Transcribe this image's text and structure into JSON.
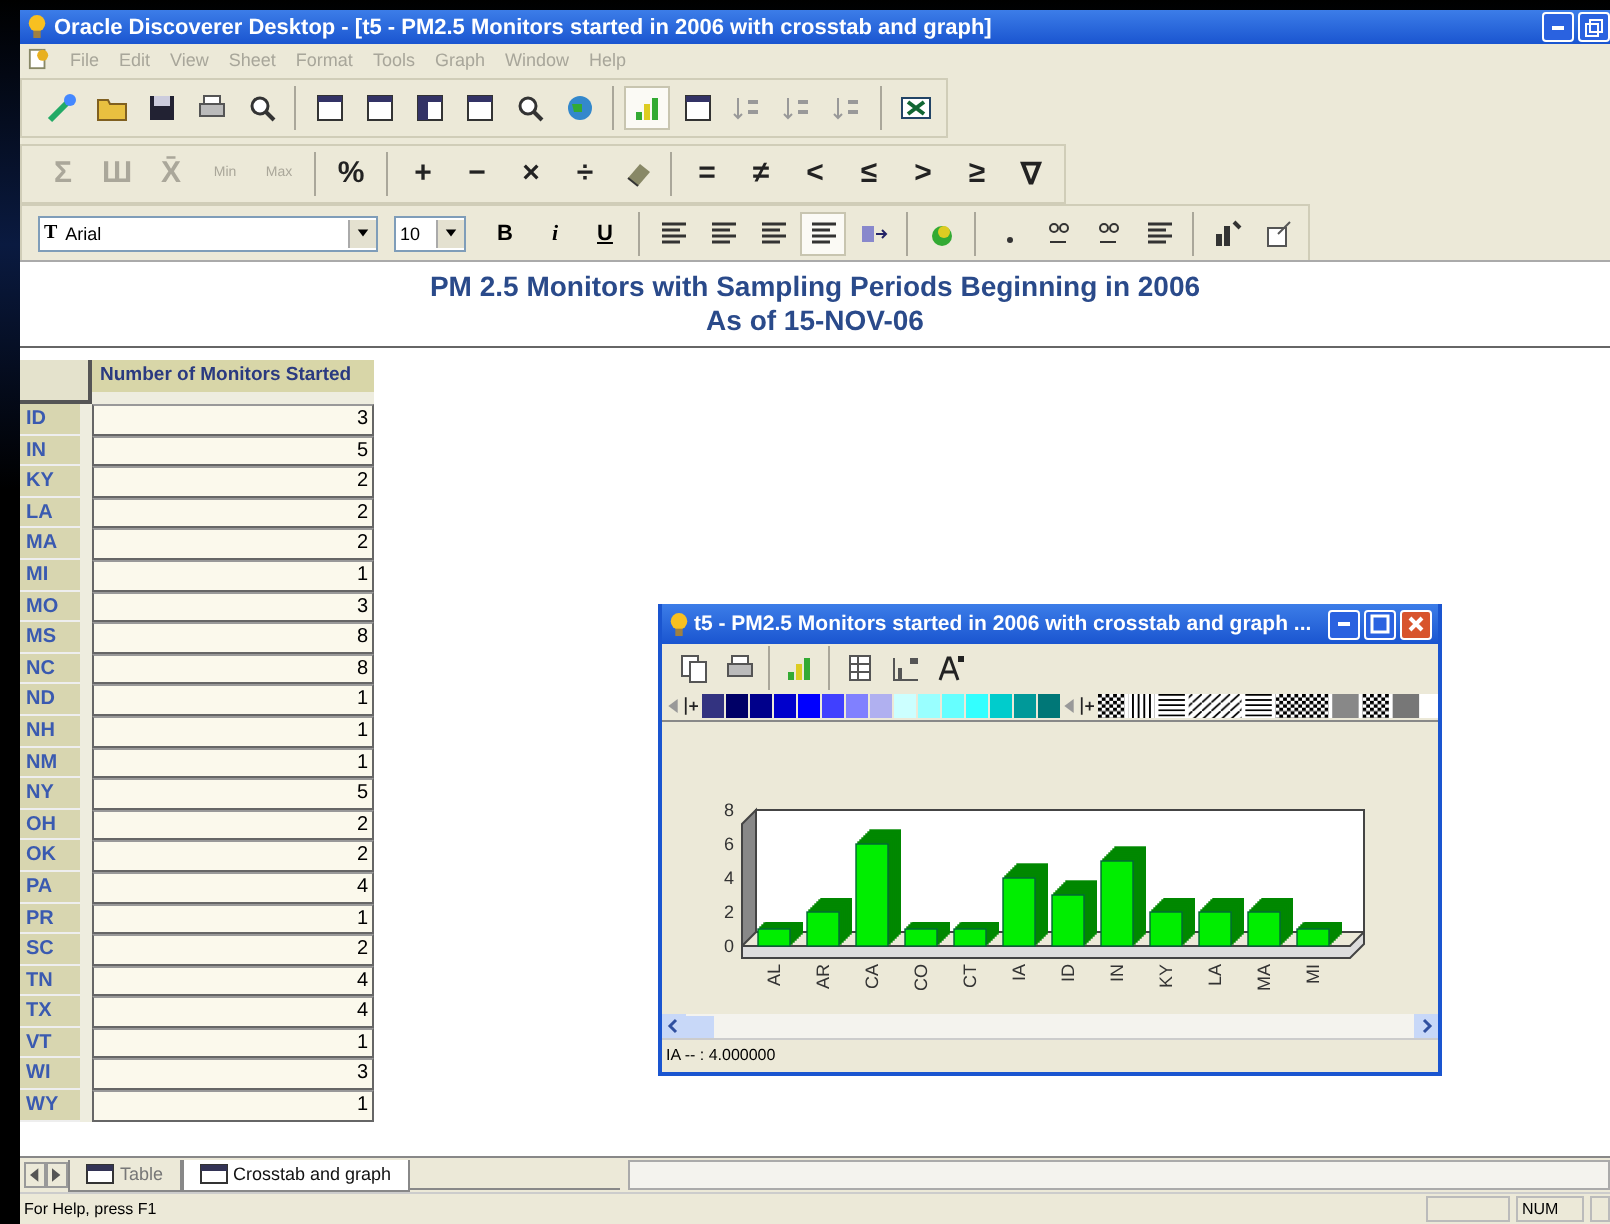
{
  "window": {
    "title": "Oracle Discoverer Desktop - [t5 - PM2.5 Monitors started in 2006 with crosstab and graph]"
  },
  "menu": [
    {
      "label": "File"
    },
    {
      "label": "Edit"
    },
    {
      "label": "View"
    },
    {
      "label": "Sheet"
    },
    {
      "label": "Format"
    },
    {
      "label": "Tools"
    },
    {
      "label": "Graph"
    },
    {
      "label": "Window"
    },
    {
      "label": "Help"
    }
  ],
  "calc_toolbar": [
    {
      "kind": "button",
      "label": "Σ",
      "disabled": true
    },
    {
      "kind": "button",
      "label": "Ш",
      "disabled": true
    },
    {
      "kind": "button",
      "label": "X̄",
      "disabled": true
    },
    {
      "kind": "button",
      "label": "Min",
      "disabled": true
    },
    {
      "kind": "button",
      "label": "Max",
      "disabled": true
    },
    {
      "kind": "sep"
    },
    {
      "kind": "button",
      "label": "%",
      "disabled": false
    },
    {
      "kind": "sep"
    },
    {
      "kind": "button",
      "label": "+",
      "disabled": false
    },
    {
      "kind": "button",
      "label": "−",
      "disabled": false
    },
    {
      "kind": "button",
      "label": "×",
      "disabled": false
    },
    {
      "kind": "button",
      "label": "÷",
      "disabled": false
    },
    {
      "kind": "eraser"
    },
    {
      "kind": "sep"
    },
    {
      "kind": "button",
      "label": "=",
      "disabled": false
    },
    {
      "kind": "button",
      "label": "≠",
      "disabled": false
    },
    {
      "kind": "button",
      "label": "<",
      "disabled": false
    },
    {
      "kind": "button",
      "label": "≤",
      "disabled": false
    },
    {
      "kind": "button",
      "label": ">",
      "disabled": false
    },
    {
      "kind": "button",
      "label": "≥",
      "disabled": false
    },
    {
      "kind": "button",
      "label": "∇",
      "disabled": false
    }
  ],
  "format_toolbar": {
    "font_glyph": "T",
    "font": "Arial",
    "size": "10",
    "bold": "B",
    "italic": "i",
    "underline": "U"
  },
  "report": {
    "title": "PM 2.5 Monitors with Sampling Periods Beginning in 2006",
    "subtitle": "As of 15-NOV-06"
  },
  "crosstab": {
    "column": "Number of Monitors Started",
    "rows": [
      {
        "state": "ID",
        "value": "3"
      },
      {
        "state": "IN",
        "value": "5"
      },
      {
        "state": "KY",
        "value": "2"
      },
      {
        "state": "LA",
        "value": "2"
      },
      {
        "state": "MA",
        "value": "2"
      },
      {
        "state": "MI",
        "value": "1"
      },
      {
        "state": "MO",
        "value": "3"
      },
      {
        "state": "MS",
        "value": "8"
      },
      {
        "state": "NC",
        "value": "8"
      },
      {
        "state": "ND",
        "value": "1"
      },
      {
        "state": "NH",
        "value": "1"
      },
      {
        "state": "NM",
        "value": "1"
      },
      {
        "state": "NY",
        "value": "5"
      },
      {
        "state": "OH",
        "value": "2"
      },
      {
        "state": "OK",
        "value": "2"
      },
      {
        "state": "PA",
        "value": "4"
      },
      {
        "state": "PR",
        "value": "1"
      },
      {
        "state": "SC",
        "value": "2"
      },
      {
        "state": "TN",
        "value": "4"
      },
      {
        "state": "TX",
        "value": "4"
      },
      {
        "state": "VT",
        "value": "1"
      },
      {
        "state": "WI",
        "value": "3"
      },
      {
        "state": "WY",
        "value": "1"
      }
    ]
  },
  "graph_window": {
    "title": "t5 - PM2.5 Monitors started in 2006 with crosstab and graph ...",
    "palette": [
      {
        "color": "#333380"
      },
      {
        "color": "#000066"
      },
      {
        "color": "#00008b"
      },
      {
        "color": "#0000cc"
      },
      {
        "color": "#0000ff"
      },
      {
        "color": "#4040ff"
      },
      {
        "color": "#8080ff"
      },
      {
        "color": "#b0b0f0"
      },
      {
        "color": "#ccffff"
      },
      {
        "color": "#99ffff"
      },
      {
        "color": "#66ffff"
      },
      {
        "color": "#33ffff"
      },
      {
        "color": "#00cccc"
      },
      {
        "color": "#009999"
      },
      {
        "color": "#007777"
      }
    ],
    "chart_data": {
      "type": "bar",
      "categories": [
        "AL",
        "AR",
        "CA",
        "CO",
        "CT",
        "IA",
        "ID",
        "IN",
        "KY",
        "LA",
        "MA",
        "MI"
      ],
      "values": [
        1,
        2,
        6,
        1,
        1,
        4,
        3,
        5,
        2,
        2,
        2,
        1
      ],
      "ylim": [
        0,
        8
      ],
      "yticks": [
        0,
        2,
        4,
        6,
        8
      ]
    },
    "status": "IA -- : 4.000000"
  },
  "sheet_tabs": [
    {
      "label": "Table",
      "selected": false
    },
    {
      "label": "Crosstab and graph",
      "selected": true
    }
  ],
  "status_bar": {
    "help": "For Help, press F1",
    "num": "NUM"
  }
}
